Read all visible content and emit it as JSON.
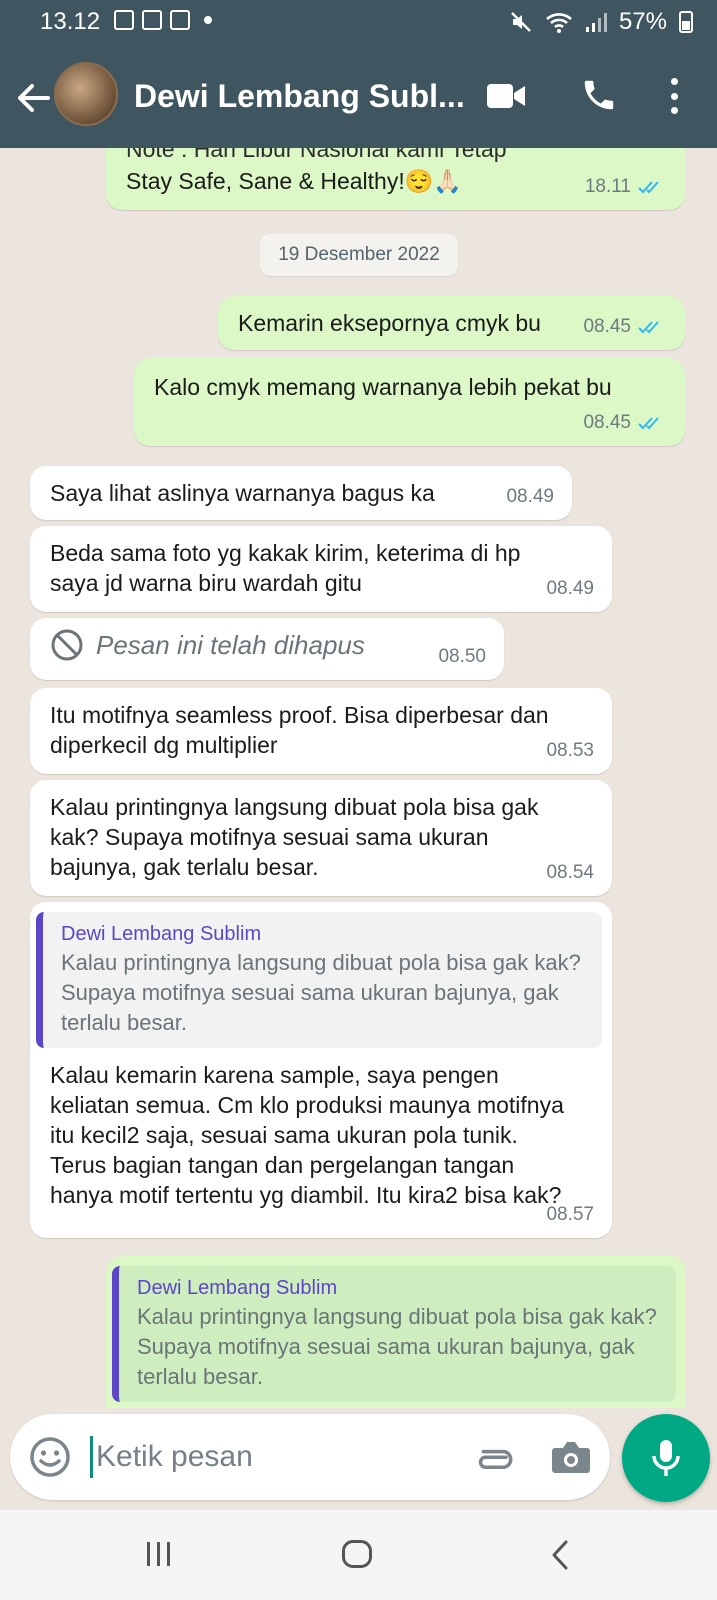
{
  "status_bar": {
    "time": "13.12",
    "battery": "57%"
  },
  "header": {
    "contact_name": "Dewi Lembang Subl..."
  },
  "chat": {
    "cut_top_text": "Note : Hari Libur Nasional kami Tetap",
    "first_msg": {
      "text": "Stay Safe, Sane & Healthy!😌🙏🏻",
      "time": "18.11"
    },
    "date_chip": "19 Desember 2022",
    "messages": [
      {
        "text": "Kemarin eksepornya cmyk bu",
        "time": "08.45"
      },
      {
        "text": "Kalo cmyk memang warnanya lebih pekat bu",
        "time": "08.45"
      },
      {
        "text": "Saya lihat aslinya warnanya bagus ka",
        "time": "08.49"
      },
      {
        "text": "Beda sama foto yg kakak kirim, keterima di hp saya jd warna biru wardah gitu",
        "time": "08.49"
      },
      {
        "text": "Pesan ini telah dihapus",
        "time": "08.50"
      },
      {
        "text": "Itu motifnya seamless proof. Bisa diperbesar dan diperkecil dg multiplier",
        "time": "08.53"
      },
      {
        "text": "Kalau printingnya langsung dibuat pola bisa gak kak? Supaya motifnya sesuai sama ukuran bajunya, gak terlalu besar.",
        "time": "08.54"
      },
      {
        "quote_name": "Dewi Lembang Sublim",
        "quote_text": "Kalau printingnya langsung dibuat pola bisa gak kak? Supaya motifnya sesuai sama ukuran bajunya, gak terlalu besar.",
        "text": "Kalau kemarin karena sample, saya pengen keliatan semua. Cm klo produksi maunya motifnya itu kecil2 saja, sesuai sama ukuran pola tunik. Terus bagian tangan dan pergelangan tangan hanya motif tertentu yg diambil. Itu kira2 bisa kak?",
        "time": "08.57"
      },
      {
        "quote_name": "Dewi Lembang Sublim",
        "quote_text": "Kalau printingnya langsung dibuat pola bisa gak kak? Supaya motifnya sesuai sama ukuran bajunya, gak terlalu besar."
      }
    ]
  },
  "input": {
    "placeholder": "Ketik pesan"
  },
  "colors": {
    "header": "#3f5660",
    "outgoing": "#dcf8c6",
    "incoming": "#ffffff",
    "accent": "#00a884",
    "quote_bar": "#5c46c8",
    "ticks": "#34b7f1"
  },
  "icons": [
    "back-arrow-icon",
    "video-call-icon",
    "phone-icon",
    "more-options-icon",
    "emoji-icon",
    "attach-icon",
    "camera-icon",
    "mic-icon",
    "deleted-icon",
    "double-tick-icon"
  ]
}
